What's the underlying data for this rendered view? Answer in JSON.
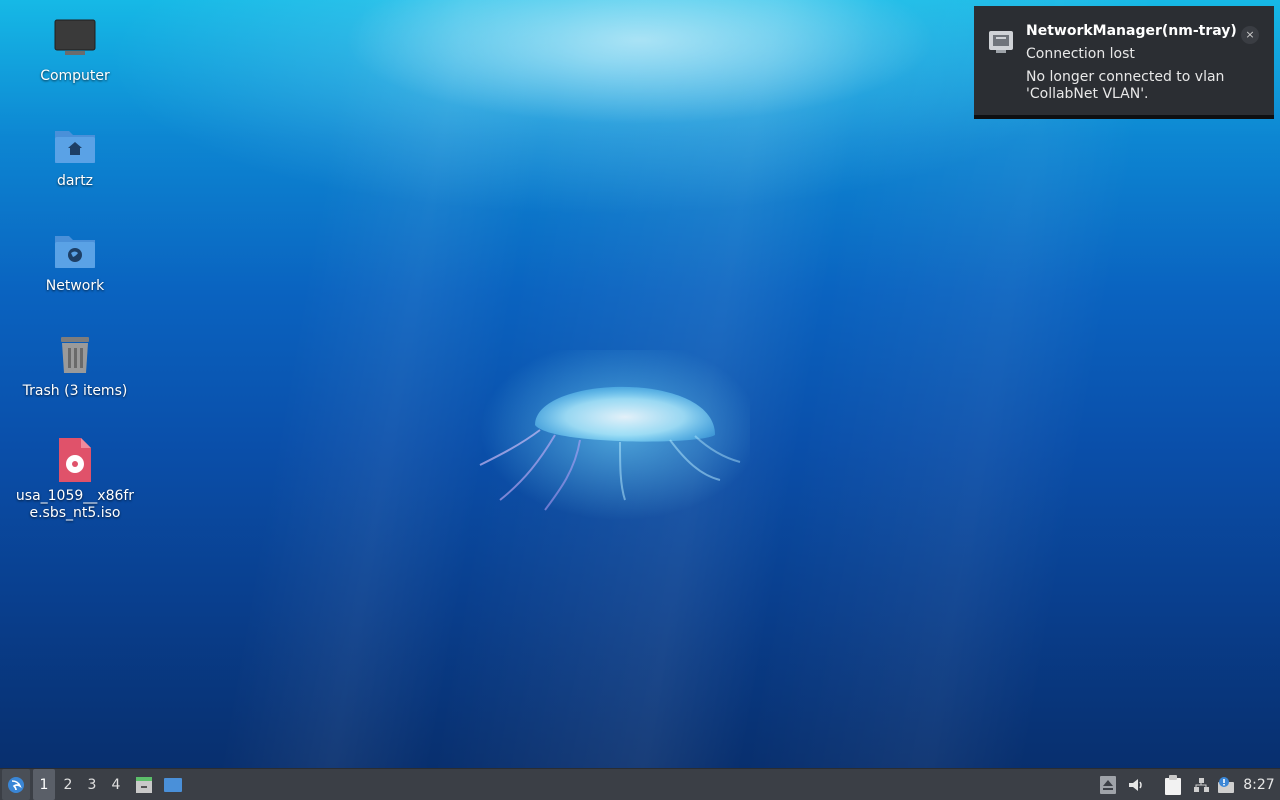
{
  "desktop": {
    "icons": [
      {
        "label": "Computer",
        "icon": "computer-icon"
      },
      {
        "label": "dartz",
        "icon": "home-folder-icon"
      },
      {
        "label": "Network",
        "icon": "network-folder-icon"
      },
      {
        "label": "Trash (3 items)",
        "icon": "trash-icon"
      },
      {
        "label": "usa_1059__x86fre.sbs_nt5.iso",
        "icon": "disc-image-file-icon"
      }
    ]
  },
  "notification": {
    "title": "NetworkManager(nm-tray)",
    "summary": "Connection lost",
    "body": "No longer connected to vlan 'CollabNet VLAN'.",
    "close": "×",
    "icon": "network-wired-icon"
  },
  "taskbar": {
    "start_icon": "start-menu-icon",
    "workspaces": [
      "1",
      "2",
      "3",
      "4"
    ],
    "active_workspace": "1",
    "launchers": [
      {
        "icon": "file-manager-icon"
      },
      {
        "icon": "show-desktop-icon"
      }
    ],
    "tray": [
      {
        "icon": "eject-icon"
      },
      {
        "icon": "volume-icon"
      },
      {
        "icon": "clipboard-icon"
      },
      {
        "icon": "network-icon"
      },
      {
        "icon": "update-notifier-icon"
      }
    ],
    "clock": "8:27"
  },
  "colors": {
    "taskbar_bg": "#3b3f46",
    "notification_bg": "#2b2e33",
    "folder_blue": "#5aa2e6",
    "iso_red": "#e0526a"
  }
}
